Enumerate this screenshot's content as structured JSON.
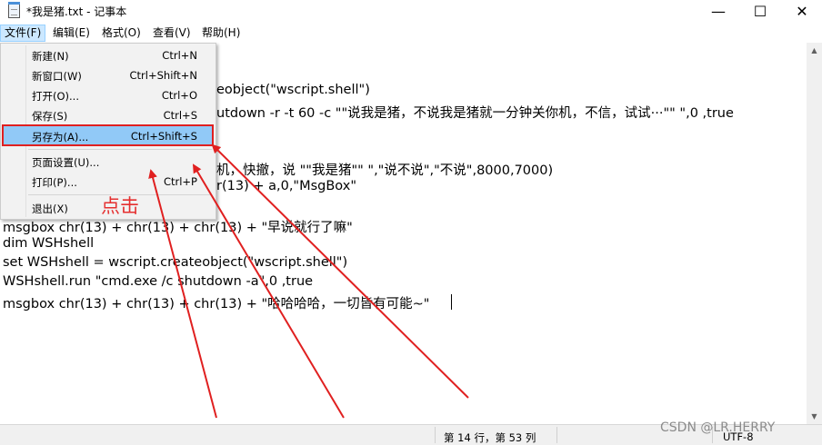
{
  "window": {
    "title": "*我是猪.txt - 记事本",
    "minimize_glyph": "—",
    "maximize_glyph": "☐",
    "close_glyph": "✕",
    "icon": "notepad-icon"
  },
  "menubar": {
    "items": [
      "文件(F)",
      "编辑(E)",
      "格式(O)",
      "查看(V)",
      "帮助(H)"
    ]
  },
  "file_menu": {
    "items": [
      {
        "label": "新建(N)",
        "shortcut": "Ctrl+N"
      },
      {
        "label": "新窗口(W)",
        "shortcut": "Ctrl+Shift+N"
      },
      {
        "label": "打开(O)...",
        "shortcut": "Ctrl+O"
      },
      {
        "label": "保存(S)",
        "shortcut": "Ctrl+S"
      },
      {
        "label": "另存为(A)...",
        "shortcut": "Ctrl+Shift+S"
      },
      {
        "label": "页面设置(U)...",
        "shortcut": ""
      },
      {
        "label": "打印(P)...",
        "shortcut": "Ctrl+P"
      },
      {
        "label": "退出(X)",
        "shortcut": ""
      }
    ],
    "highlight_color": "#91c9f7"
  },
  "editor": {
    "lines": [
      "eobject(\"wscript.shell\")",
      "utdown -r -t 60 -c \"\"说我是猪，不说我是猪就一分钟关你机，不信，试试···\"\" \",0 ,true",
      "机，快撤，说 \"\"我是猪\"\" \",\"说不说\",\"不说\",8000,7000)",
      "r(13) + a,0,\"MsgBox\"",
      "msgbox chr(13) + chr(13) + chr(13) + \"早说就行了嘛\"",
      "dim WSHshell",
      "set WSHshell = wscript.createobject(\"wscript.shell\")",
      "WSHshell.run \"cmd.exe /c shutdown -a\",0 ,true",
      "msgbox chr(13) + chr(13) + chr(13) + \"哈哈哈哈，一切皆有可能~\""
    ]
  },
  "statusbar": {
    "position": "第 14 行，第 53 列",
    "encoding": "UTF-8"
  },
  "annotation": {
    "click_text": "点击",
    "color": "#e02020"
  },
  "watermark": "CSDN @LR.HERRY"
}
